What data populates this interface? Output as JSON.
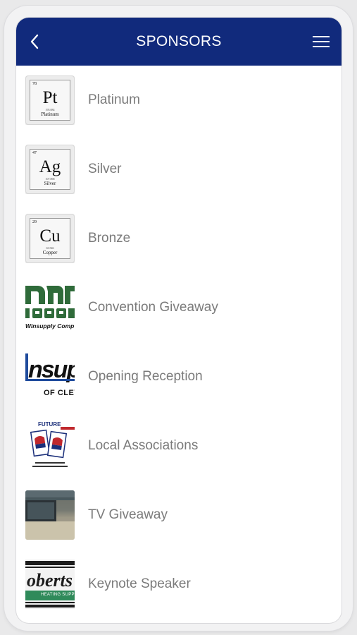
{
  "header": {
    "title": "SPONSORS",
    "back_icon": "chevron-left-icon",
    "menu_icon": "hamburger-menu-icon",
    "bg_color": "#112a7c"
  },
  "sponsors": [
    {
      "label": "Platinum",
      "thumb": {
        "kind": "element",
        "number": "78",
        "symbol": "Pt",
        "mass": "195.084",
        "name": "Platinum"
      }
    },
    {
      "label": "Silver",
      "thumb": {
        "kind": "element",
        "number": "47",
        "symbol": "Ag",
        "mass": "107.868",
        "name": "Silver"
      }
    },
    {
      "label": "Bronze",
      "thumb": {
        "kind": "element",
        "number": "29",
        "symbol": "Cu",
        "mass": "63.546",
        "name": "Copper"
      }
    },
    {
      "label": "Convention Giveaway",
      "thumb": {
        "kind": "logo",
        "text": "Winsupply Comp"
      }
    },
    {
      "label": "Opening Reception",
      "thumb": {
        "kind": "logo",
        "text": "OF CLEVE"
      }
    },
    {
      "label": "Local Associations",
      "thumb": {
        "kind": "logo",
        "text": "FUTURE"
      }
    },
    {
      "label": "TV Giveaway",
      "thumb": {
        "kind": "photo"
      }
    },
    {
      "label": "Keynote Speaker",
      "thumb": {
        "kind": "logo",
        "text": "HEATING SUPP"
      }
    }
  ]
}
